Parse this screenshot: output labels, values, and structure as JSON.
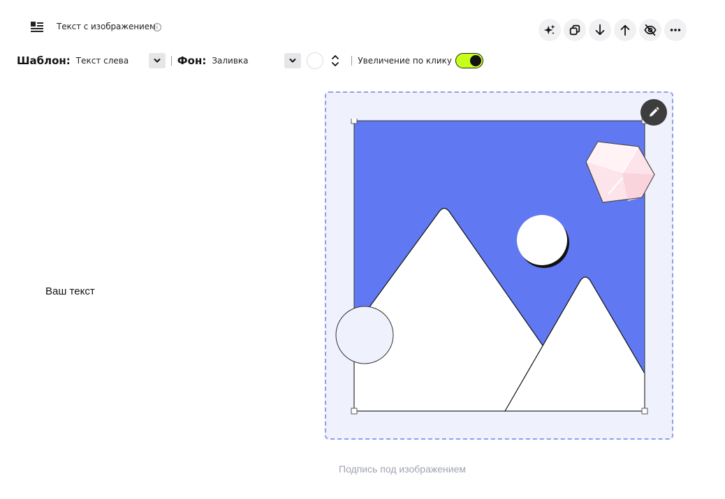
{
  "header": {
    "title": "Текст с изображением",
    "info_glyph": "i",
    "icon": "text-image-block-icon"
  },
  "toolbar": {
    "icons": [
      "sparkle-icon",
      "duplicate-icon",
      "arrow-down-icon",
      "arrow-up-icon",
      "eye-off-icon",
      "more-icon"
    ]
  },
  "settings": {
    "template_label": "Шаблон:",
    "template_value": "Текст слева",
    "background_label": "Фон:",
    "background_value": "Заливка",
    "zoom_label": "Увеличение по клику",
    "zoom_enabled": true
  },
  "content": {
    "text": "Ваш текст",
    "caption": "Подпись под изображением"
  },
  "colors": {
    "accent_toggle": "#c6ff1a",
    "sky": "#6079f2",
    "frame_bg": "#eff1fd",
    "frame_border": "#8fa0e8"
  }
}
